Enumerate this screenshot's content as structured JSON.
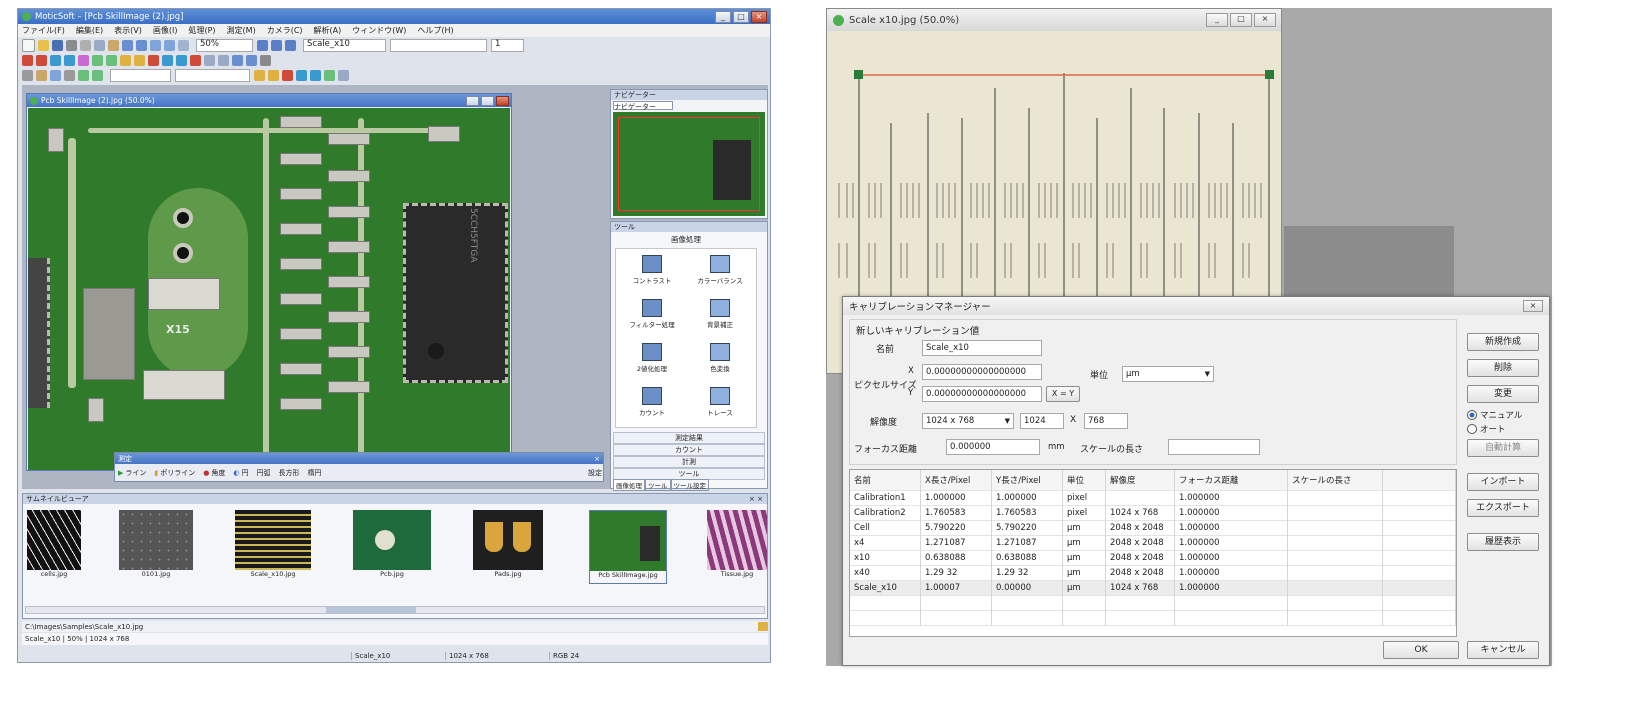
{
  "left_app": {
    "title": "MoticSoft – [Pcb SkillImage (2).jpg]",
    "menu": [
      "ファイル(F)",
      "編集(E)",
      "表示(V)",
      "画像(I)",
      "処理(P)",
      "測定(M)",
      "カメラ(C)",
      "解析(A)",
      "ウィンドウ(W)",
      "ヘルプ(H)"
    ],
    "toolbar_zoom": "50%",
    "toolbar_combo": "Scale_x10",
    "toolbar_value": "1",
    "image_window_title": "Pcb SkillImage (2).jpg (50.0%)",
    "chip_text": "5CCH5FTGA",
    "chip_label": "X15",
    "navigator_title": "ナビゲーター",
    "navigator_tab": "ナビゲーター",
    "tools_title": "ツール",
    "tools_header": "画像処理",
    "tools": [
      "コントラスト",
      "カラーバランス",
      "フィルター処理",
      "背景補正",
      "2値化処理",
      "色変換",
      "カウント",
      "トレース"
    ],
    "tools_list": [
      "測定結果",
      "カウント",
      "計測",
      "ツール"
    ],
    "tools_tabs": [
      "画像処理",
      "ツール",
      "ツール設定"
    ],
    "measure_bar_title": "測定",
    "measure_bar_items": [
      "ライン",
      "ポリライン",
      "角度",
      "円",
      "円弧",
      "長方形",
      "楕円",
      "設定"
    ],
    "gallery_title": "サムネイルビューア",
    "thumbnails": [
      "cells.jpg",
      "0101.jpg",
      "Scale_x10.jpg",
      "Pcb.jpg",
      "Pads.jpg",
      "Pcb SkillImage.jpg",
      "Tissue.jpg"
    ],
    "status_path": "C:\\Images\\Samples\\Scale_x10.jpg",
    "status_row2": "Scale_x10 | 50% | 1024 x 768",
    "status_cells": [
      "",
      "Scale_x10",
      "1024 x 768",
      "RGB 24"
    ],
    "colors": {
      "title_bar": "#3a6fc4",
      "pcb_green": "#2f7a2b",
      "chip": "#2a2a2a"
    }
  },
  "right_app": {
    "image_window_title": "Scale x10.jpg (50.0%)",
    "dialog": {
      "title": "キャリブレーションマネージャー",
      "section": "新しいキャリブレーション値",
      "name_label": "名前",
      "name_value": "Scale_x10",
      "pixel_size_label": "ピクセルサイズ",
      "x_label": "X",
      "y_label": "Y",
      "x_value": "0.00000000000000000",
      "y_value": "0.00000000000000000",
      "xy_button": "X = Y",
      "unit_label": "単位",
      "unit_value": "μm",
      "resolution_label": "解像度",
      "resolution_value": "1024 x 768",
      "res_w": "1024",
      "res_x": "X",
      "res_h": "768",
      "focus_label": "フォーカス距離",
      "focus_value": "0.000000",
      "focus_unit": "mm",
      "scale_length_label": "スケールの長さ",
      "scale_length_value": "",
      "buttons_right": [
        "新規作成",
        "削除",
        "変更"
      ],
      "radio_options": [
        "マニュアル",
        "オート"
      ],
      "auto_button": "自動計算",
      "import_button": "インポート",
      "export_button": "エクスポート",
      "report_button": "履歴表示",
      "table_headers": [
        "名前",
        "X長さ/Pixel",
        "Y長さ/Pixel",
        "単位",
        "解像度",
        "フォーカス距離",
        "スケールの長さ"
      ],
      "table_rows": [
        [
          "Calibration1",
          "1.000000",
          "1.000000",
          "pixel",
          "",
          "1.000000",
          ""
        ],
        [
          "Calibration2",
          "1.760583",
          "1.760583",
          "pixel",
          "1024 x 768",
          "1.000000",
          ""
        ],
        [
          "Cell",
          "5.790220",
          "5.790220",
          "μm",
          "2048 x 2048",
          "1.000000",
          ""
        ],
        [
          "x4",
          "1.271087",
          "1.271087",
          "μm",
          "2048 x 2048",
          "1.000000",
          ""
        ],
        [
          "x10",
          "0.638088",
          "0.638088",
          "μm",
          "2048 x 2048",
          "1.000000",
          ""
        ],
        [
          "x40",
          "1.29 32",
          "1.29 32",
          "μm",
          "2048 x 2048",
          "1.000000",
          ""
        ],
        [
          "Scale_x10",
          "1.00007",
          "0.00000",
          "μm",
          "1024 x 768",
          "1.000000",
          ""
        ]
      ],
      "ok_button": "OK",
      "cancel_button": "キャンセル"
    }
  }
}
